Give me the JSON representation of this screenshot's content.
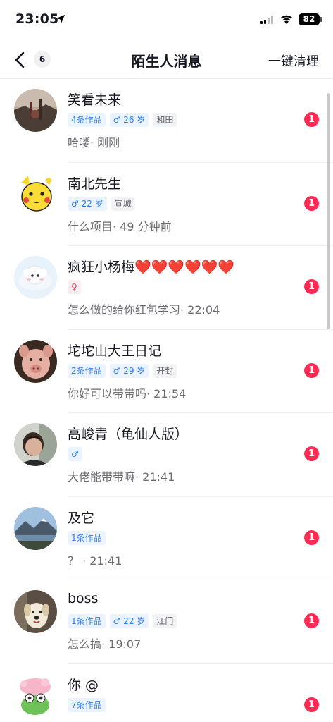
{
  "status_bar": {
    "time": "23:05",
    "battery": "82"
  },
  "nav": {
    "badge_count": "6",
    "title": "陌生人消息",
    "clear_label": "一键清理"
  },
  "conversations": [
    {
      "name": "笑看未来",
      "tags": [
        {
          "kind": "works",
          "text": "4条作品"
        },
        {
          "kind": "male",
          "text": "♂ 26 岁"
        },
        {
          "kind": "city",
          "text": "和田"
        }
      ],
      "preview": "哈喽· 刚刚",
      "unread": "1",
      "avatar_icon": "landscape-photo-icon"
    },
    {
      "name": "南北先生",
      "tags": [
        {
          "kind": "male",
          "text": "♂ 22 岁"
        },
        {
          "kind": "city",
          "text": "宣城"
        }
      ],
      "preview": "什么项目· 49 分钟前",
      "unread": "1",
      "avatar_icon": "cartoon-pikachu-icon"
    },
    {
      "name": "疯狂小杨梅❤️❤️❤️❤️❤️❤️",
      "tags": [
        {
          "kind": "female",
          "text": "♀"
        }
      ],
      "preview": "怎么做的给你红包学习· 22:04",
      "unread": "1",
      "avatar_icon": "cartoon-sheep-icon"
    },
    {
      "name": "坨坨山大王日记",
      "tags": [
        {
          "kind": "works",
          "text": "2条作品"
        },
        {
          "kind": "male",
          "text": "♂ 29 岁"
        },
        {
          "kind": "city",
          "text": "开封"
        }
      ],
      "preview": "你好可以带带吗· 21:54",
      "unread": "1",
      "avatar_icon": "pig-photo-icon"
    },
    {
      "name": "高峻青（龟仙人版）",
      "tags": [
        {
          "kind": "male",
          "text": "♂"
        }
      ],
      "preview": "大佬能带带嘛· 21:41",
      "unread": "1",
      "avatar_icon": "person-photo-icon"
    },
    {
      "name": "及它",
      "tags": [
        {
          "kind": "works",
          "text": "1条作品"
        }
      ],
      "preview": "？ · 21:41",
      "unread": "1",
      "avatar_icon": "mountain-lake-photo-icon"
    },
    {
      "name": "boss",
      "tags": [
        {
          "kind": "works",
          "text": "1条作品"
        },
        {
          "kind": "male",
          "text": "♂ 22 岁"
        },
        {
          "kind": "city",
          "text": "江门"
        }
      ],
      "preview": "怎么搞· 19:07",
      "unread": "1",
      "avatar_icon": "dog-photo-icon"
    },
    {
      "name": "你 @",
      "tags": [
        {
          "kind": "works",
          "text": "7条作品"
        }
      ],
      "preview": "",
      "unread": "1",
      "avatar_icon": "cartoon-frog-icon"
    }
  ]
}
